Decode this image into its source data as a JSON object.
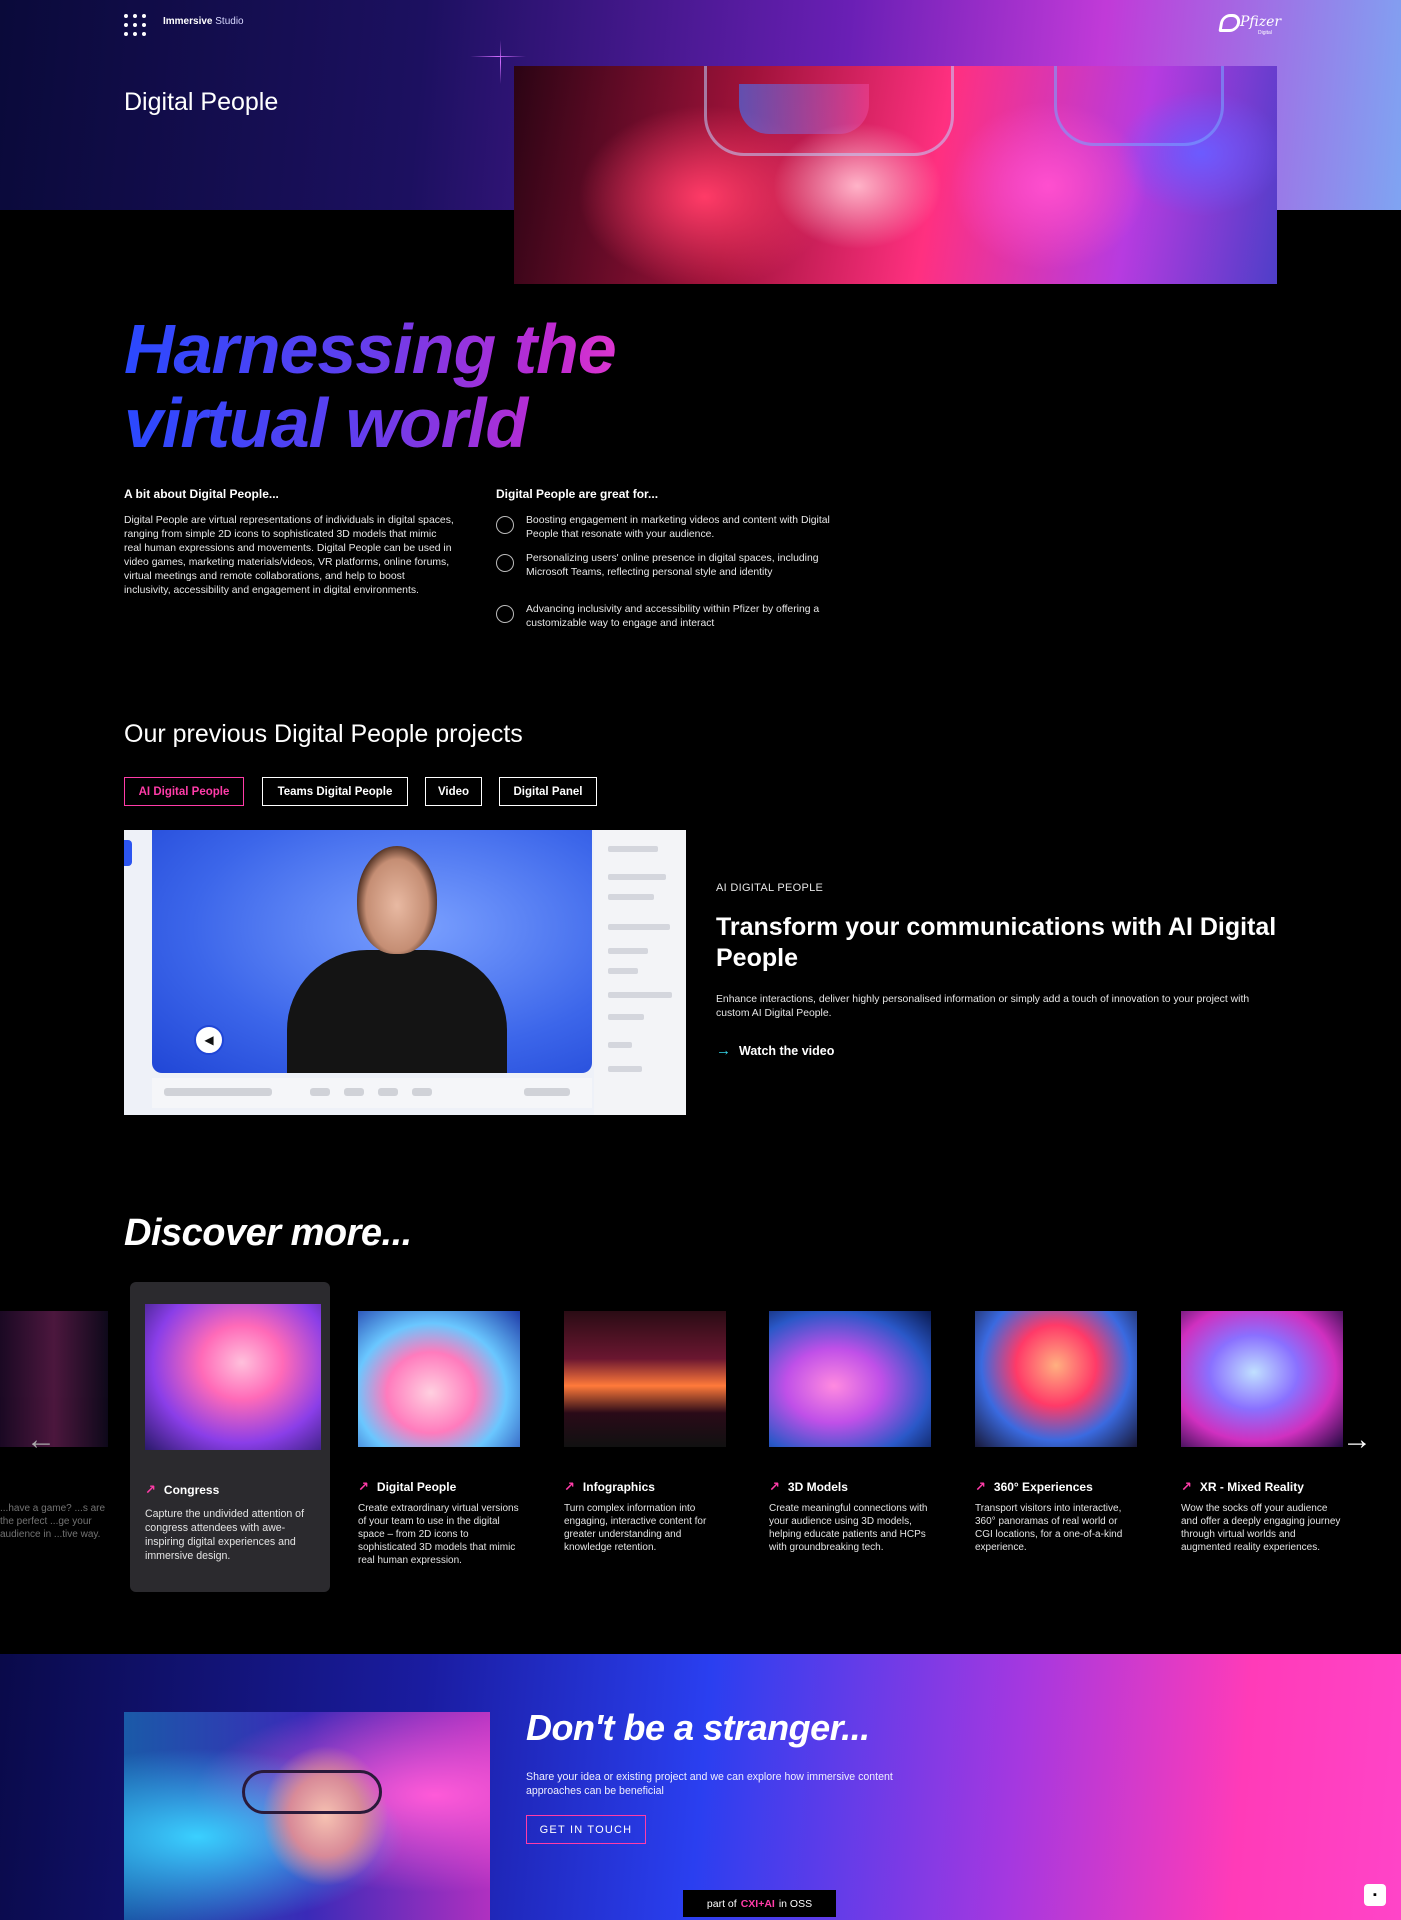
{
  "header": {
    "brand_bold": "Immersive",
    "brand_light": "Studio",
    "logo_word": "Pfizer",
    "logo_sub": "Digital",
    "page_title": "Digital People"
  },
  "headline": {
    "line1": "Harnessing the",
    "line2": "virtual world"
  },
  "about": {
    "heading": "A bit about Digital People...",
    "body": "Digital People are virtual representations of individuals in digital spaces, ranging from simple 2D icons to sophisticated 3D models that mimic real human expressions and movements. Digital People can be used in video games, marketing materials/videos, VR platforms, online forums, virtual meetings and remote collaborations, and help to boost inclusivity, accessibility and engagement in digital environments."
  },
  "great_for": {
    "heading": "Digital People are great for...",
    "items": [
      {
        "icon": "people-icon",
        "text": "Boosting engagement in marketing videos and content with Digital People that resonate with your audience."
      },
      {
        "icon": "thumbs-up-icon",
        "text": "Personalizing users' online presence in digital spaces, including Microsoft Teams, reflecting personal style and identity"
      },
      {
        "icon": "accessibility-icon",
        "text": "Advancing inclusivity and accessibility within Pfizer by offering a customizable way to engage and interact"
      }
    ]
  },
  "projects": {
    "section_title": "Our previous Digital People projects",
    "tabs": [
      "AI Digital People",
      "Teams Digital People",
      "Video",
      "Digital Panel"
    ],
    "active_tab": 0,
    "kicker": "AI DIGITAL PEOPLE",
    "title": "Transform your communications with AI Digital People",
    "description": "Enhance interactions, deliver highly personalised information or simply add a touch of innovation to your project with custom AI Digital People.",
    "watch_label": "Watch the video"
  },
  "discover": {
    "title": "Discover more...",
    "edge_card_desc": "...have a game? ...s are the perfect ...ge your audience in ...tive way.",
    "cards": [
      {
        "title": "Congress",
        "desc": "Capture the undivided attention of congress attendees with awe-inspiring digital experiences and immersive design."
      },
      {
        "title": "Digital People",
        "desc": "Create extraordinary virtual versions of your team to use in the digital space – from 2D icons to sophisticated 3D models that mimic real human expression."
      },
      {
        "title": "Infographics",
        "desc": "Turn complex information into engaging, interactive content for greater understanding and knowledge retention."
      },
      {
        "title": "3D Models",
        "desc": "Create meaningful connections with your audience using 3D models, helping educate patients and HCPs with groundbreaking tech."
      },
      {
        "title": "360° Experiences",
        "desc": "Transport visitors into interactive, 360° panoramas of real world or CGI locations, for a one-of-a-kind experience."
      },
      {
        "title": "XR - Mixed Reality",
        "desc": "Wow the socks off your audience and offer a deeply engaging journey through virtual worlds and augmented reality experiences."
      }
    ]
  },
  "cta": {
    "title": "Don't be a stranger...",
    "description": "Share your idea or existing project and we can explore how immersive content approaches can be beneficial",
    "button": "GET IN TOUCH"
  },
  "footer": {
    "prefix": "part of",
    "accent": "CXI+AI",
    "suffix": "in OSS"
  },
  "colors": {
    "accent_pink": "#ff3ca8",
    "accent_cyan": "#34d6e8",
    "headline_start": "#2a49ff",
    "headline_end": "#f23fd0"
  }
}
